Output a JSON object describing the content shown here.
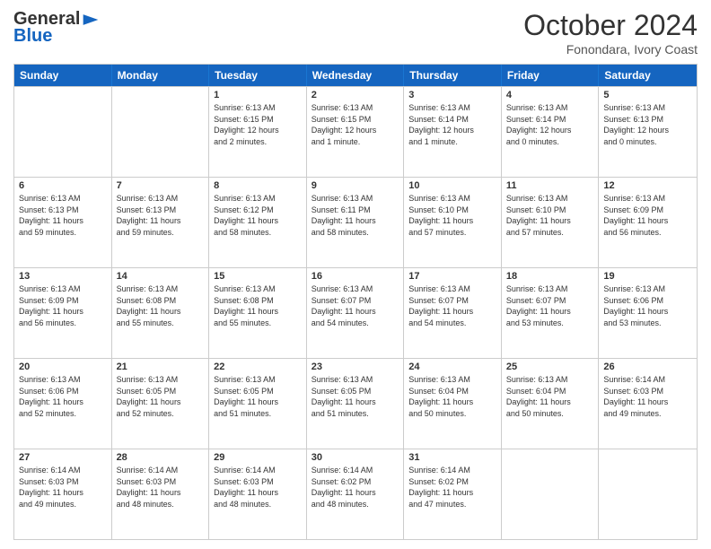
{
  "logo": {
    "general": "General",
    "blue": "Blue"
  },
  "title": "October 2024",
  "subtitle": "Fonondara, Ivory Coast",
  "header_days": [
    "Sunday",
    "Monday",
    "Tuesday",
    "Wednesday",
    "Thursday",
    "Friday",
    "Saturday"
  ],
  "weeks": [
    [
      {
        "day": "",
        "info": ""
      },
      {
        "day": "",
        "info": ""
      },
      {
        "day": "1",
        "info": "Sunrise: 6:13 AM\nSunset: 6:15 PM\nDaylight: 12 hours\nand 2 minutes."
      },
      {
        "day": "2",
        "info": "Sunrise: 6:13 AM\nSunset: 6:15 PM\nDaylight: 12 hours\nand 1 minute."
      },
      {
        "day": "3",
        "info": "Sunrise: 6:13 AM\nSunset: 6:14 PM\nDaylight: 12 hours\nand 1 minute."
      },
      {
        "day": "4",
        "info": "Sunrise: 6:13 AM\nSunset: 6:14 PM\nDaylight: 12 hours\nand 0 minutes."
      },
      {
        "day": "5",
        "info": "Sunrise: 6:13 AM\nSunset: 6:13 PM\nDaylight: 12 hours\nand 0 minutes."
      }
    ],
    [
      {
        "day": "6",
        "info": "Sunrise: 6:13 AM\nSunset: 6:13 PM\nDaylight: 11 hours\nand 59 minutes."
      },
      {
        "day": "7",
        "info": "Sunrise: 6:13 AM\nSunset: 6:13 PM\nDaylight: 11 hours\nand 59 minutes."
      },
      {
        "day": "8",
        "info": "Sunrise: 6:13 AM\nSunset: 6:12 PM\nDaylight: 11 hours\nand 58 minutes."
      },
      {
        "day": "9",
        "info": "Sunrise: 6:13 AM\nSunset: 6:11 PM\nDaylight: 11 hours\nand 58 minutes."
      },
      {
        "day": "10",
        "info": "Sunrise: 6:13 AM\nSunset: 6:10 PM\nDaylight: 11 hours\nand 57 minutes."
      },
      {
        "day": "11",
        "info": "Sunrise: 6:13 AM\nSunset: 6:10 PM\nDaylight: 11 hours\nand 57 minutes."
      },
      {
        "day": "12",
        "info": "Sunrise: 6:13 AM\nSunset: 6:09 PM\nDaylight: 11 hours\nand 56 minutes."
      }
    ],
    [
      {
        "day": "13",
        "info": "Sunrise: 6:13 AM\nSunset: 6:09 PM\nDaylight: 11 hours\nand 56 minutes."
      },
      {
        "day": "14",
        "info": "Sunrise: 6:13 AM\nSunset: 6:08 PM\nDaylight: 11 hours\nand 55 minutes."
      },
      {
        "day": "15",
        "info": "Sunrise: 6:13 AM\nSunset: 6:08 PM\nDaylight: 11 hours\nand 55 minutes."
      },
      {
        "day": "16",
        "info": "Sunrise: 6:13 AM\nSunset: 6:07 PM\nDaylight: 11 hours\nand 54 minutes."
      },
      {
        "day": "17",
        "info": "Sunrise: 6:13 AM\nSunset: 6:07 PM\nDaylight: 11 hours\nand 54 minutes."
      },
      {
        "day": "18",
        "info": "Sunrise: 6:13 AM\nSunset: 6:07 PM\nDaylight: 11 hours\nand 53 minutes."
      },
      {
        "day": "19",
        "info": "Sunrise: 6:13 AM\nSunset: 6:06 PM\nDaylight: 11 hours\nand 53 minutes."
      }
    ],
    [
      {
        "day": "20",
        "info": "Sunrise: 6:13 AM\nSunset: 6:06 PM\nDaylight: 11 hours\nand 52 minutes."
      },
      {
        "day": "21",
        "info": "Sunrise: 6:13 AM\nSunset: 6:05 PM\nDaylight: 11 hours\nand 52 minutes."
      },
      {
        "day": "22",
        "info": "Sunrise: 6:13 AM\nSunset: 6:05 PM\nDaylight: 11 hours\nand 51 minutes."
      },
      {
        "day": "23",
        "info": "Sunrise: 6:13 AM\nSunset: 6:05 PM\nDaylight: 11 hours\nand 51 minutes."
      },
      {
        "day": "24",
        "info": "Sunrise: 6:13 AM\nSunset: 6:04 PM\nDaylight: 11 hours\nand 50 minutes."
      },
      {
        "day": "25",
        "info": "Sunrise: 6:13 AM\nSunset: 6:04 PM\nDaylight: 11 hours\nand 50 minutes."
      },
      {
        "day": "26",
        "info": "Sunrise: 6:14 AM\nSunset: 6:03 PM\nDaylight: 11 hours\nand 49 minutes."
      }
    ],
    [
      {
        "day": "27",
        "info": "Sunrise: 6:14 AM\nSunset: 6:03 PM\nDaylight: 11 hours\nand 49 minutes."
      },
      {
        "day": "28",
        "info": "Sunrise: 6:14 AM\nSunset: 6:03 PM\nDaylight: 11 hours\nand 48 minutes."
      },
      {
        "day": "29",
        "info": "Sunrise: 6:14 AM\nSunset: 6:03 PM\nDaylight: 11 hours\nand 48 minutes."
      },
      {
        "day": "30",
        "info": "Sunrise: 6:14 AM\nSunset: 6:02 PM\nDaylight: 11 hours\nand 48 minutes."
      },
      {
        "day": "31",
        "info": "Sunrise: 6:14 AM\nSunset: 6:02 PM\nDaylight: 11 hours\nand 47 minutes."
      },
      {
        "day": "",
        "info": ""
      },
      {
        "day": "",
        "info": ""
      }
    ]
  ]
}
